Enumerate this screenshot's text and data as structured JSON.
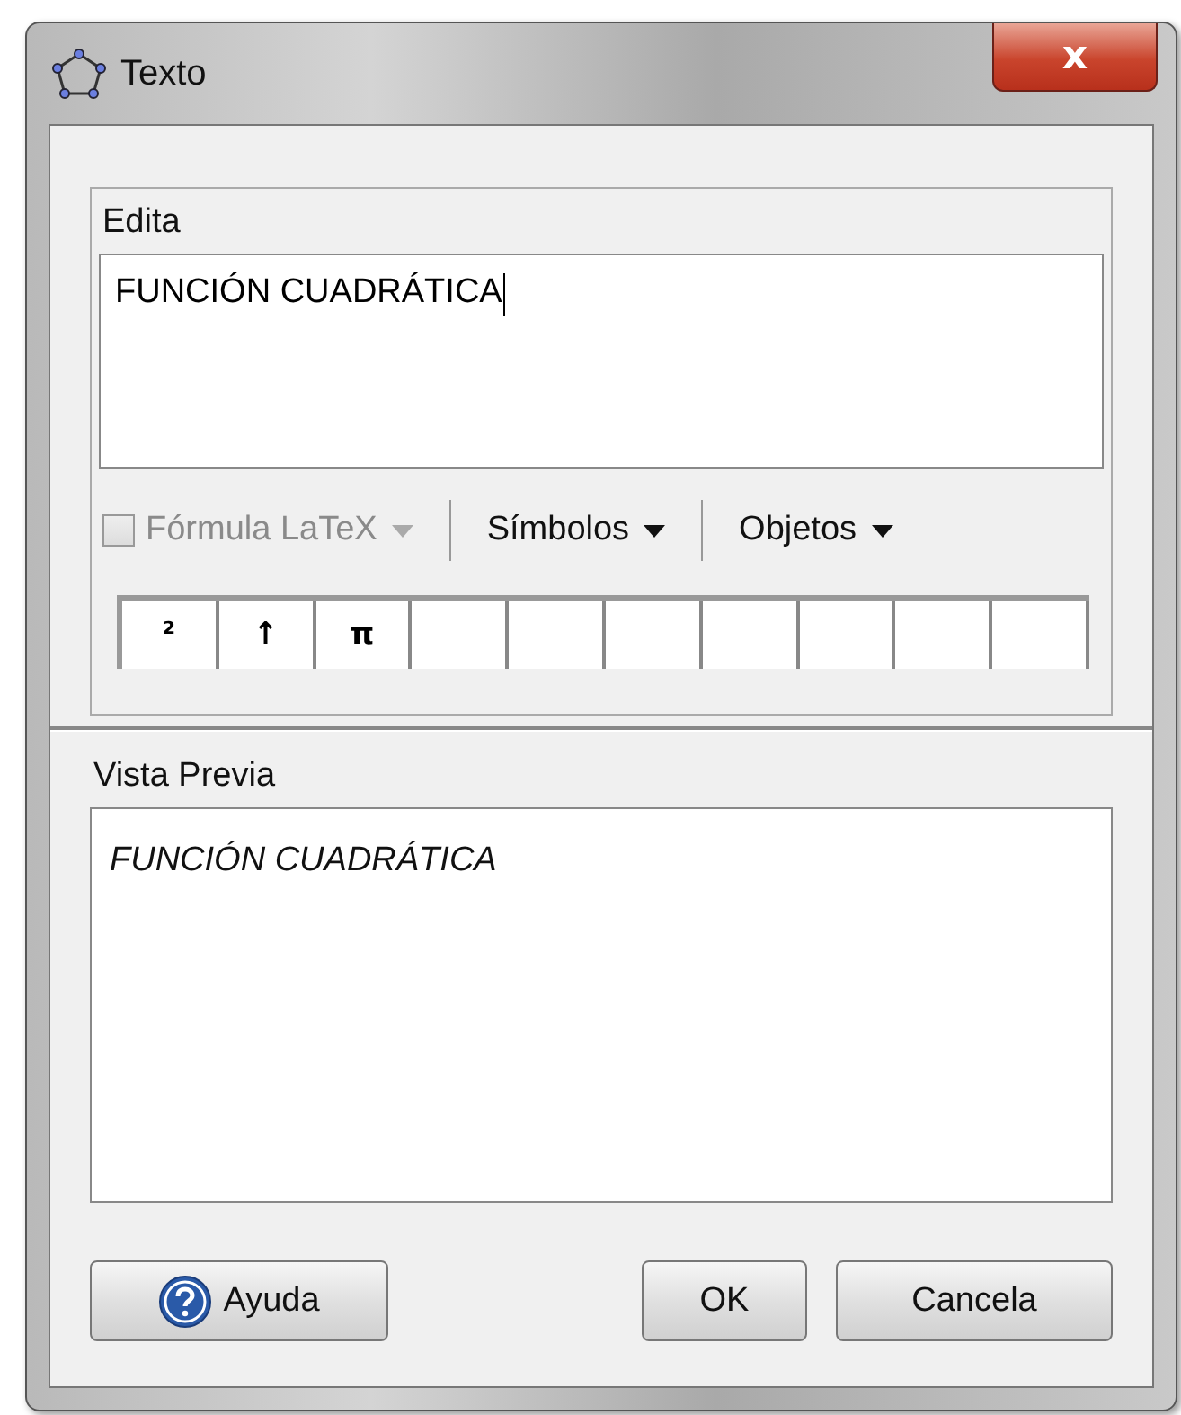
{
  "window": {
    "title": "Texto",
    "close": "x"
  },
  "edit": {
    "label": "Edita",
    "value": "FUNCIÓN CUADRÁTICA"
  },
  "toolbar": {
    "latex": {
      "label": "Fórmula LaTeX",
      "checked": false,
      "disabled": true
    },
    "menus": [
      {
        "label": "Símbolos"
      },
      {
        "label": "Objetos"
      }
    ],
    "symbols": [
      "²",
      "↑",
      "π"
    ]
  },
  "preview": {
    "label": "Vista Previa",
    "text": "FUNCIÓN CUADRÁTICA"
  },
  "buttons": [
    {
      "kind": "help",
      "label": "Ayuda"
    },
    {
      "kind": "ok",
      "label": "OK"
    },
    {
      "kind": "cancel",
      "label": "Cancela"
    }
  ]
}
